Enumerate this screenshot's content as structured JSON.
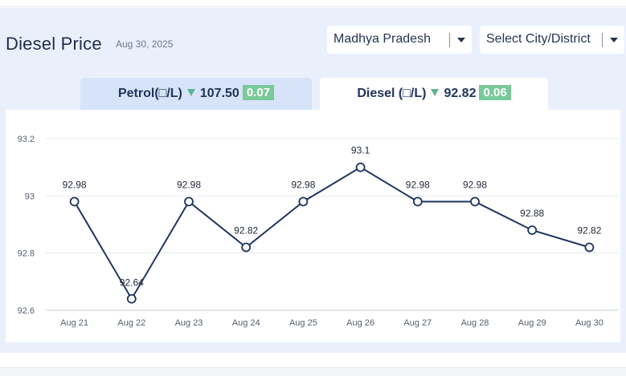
{
  "header": {
    "title": "Diesel Price",
    "date": "Aug 30, 2025"
  },
  "filters": {
    "state": "Madhya Pradesh",
    "city_placeholder": "Select City/District"
  },
  "tabs": [
    {
      "label": "Petrol(□/L)",
      "price": "107.50",
      "change": "0.07",
      "trend": "down"
    },
    {
      "label": "Diesel (□/L)",
      "price": "92.82",
      "change": "0.06",
      "trend": "down"
    }
  ],
  "colors": {
    "line": "#1e3560",
    "badge": "#79c99a",
    "arrow": "#5fb38a",
    "panel": "#eaf0fb"
  },
  "chart_data": {
    "type": "line",
    "categories": [
      "Aug 21",
      "Aug 22",
      "Aug 23",
      "Aug 24",
      "Aug 25",
      "Aug 26",
      "Aug 27",
      "Aug 28",
      "Aug 29",
      "Aug 30"
    ],
    "values": [
      92.98,
      92.64,
      92.98,
      92.82,
      92.98,
      93.1,
      92.98,
      92.98,
      92.88,
      92.82
    ],
    "data_labels": [
      "92.98",
      "92.64",
      "92.98",
      "92.82",
      "92.98",
      "93.1",
      "92.98",
      "92.98",
      "92.88",
      "92.82"
    ],
    "y_ticks": [
      92.6,
      92.8,
      93,
      93.2
    ],
    "y_tick_labels": [
      "92.6",
      "92.8",
      "93",
      "93.2"
    ],
    "ylim": [
      92.6,
      93.2
    ],
    "grid": true,
    "legend": "none"
  }
}
